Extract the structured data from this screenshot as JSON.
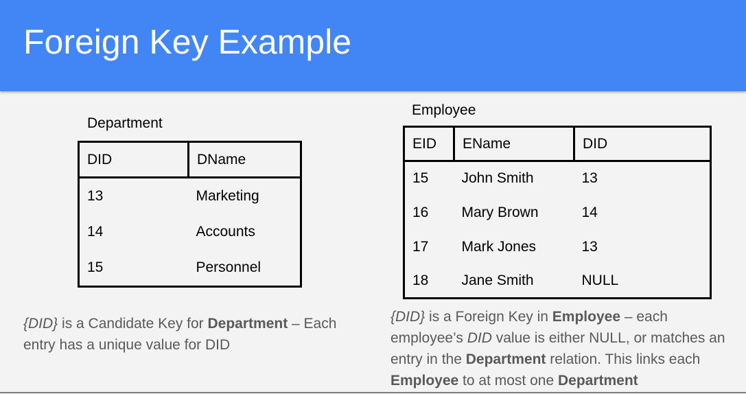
{
  "slide": {
    "title": "Foreign Key Example"
  },
  "department": {
    "caption": "Department",
    "headers": [
      "DID",
      "DName"
    ],
    "rows": [
      [
        "13",
        "Marketing"
      ],
      [
        "14",
        "Accounts"
      ],
      [
        "15",
        "Personnel"
      ]
    ]
  },
  "employee": {
    "caption": "Employee",
    "headers": [
      "EID",
      "EName",
      "DID"
    ],
    "rows": [
      [
        "15",
        "John Smith",
        "13"
      ],
      [
        "16",
        "Mary Brown",
        "14"
      ],
      [
        "17",
        "Mark Jones",
        "13"
      ],
      [
        "18",
        "Jane Smith",
        "NULL"
      ]
    ]
  },
  "notes": {
    "left": {
      "key": "{DID}",
      "t1": " is a Candidate Key for ",
      "b1": "Department",
      "t2": " – Each entry has a unique value for DID"
    },
    "right": {
      "key": "{DID}",
      "t1": " is a Foreign Key in ",
      "b1": "Employee",
      "t2": " – each employee’s ",
      "i1": "DID",
      "t3": " value is either NULL, or matches an entry in the ",
      "b2": "Department",
      "t4": " relation. This links each ",
      "b3": "Employee",
      "t5": " to at most one ",
      "b4": "Department"
    }
  }
}
